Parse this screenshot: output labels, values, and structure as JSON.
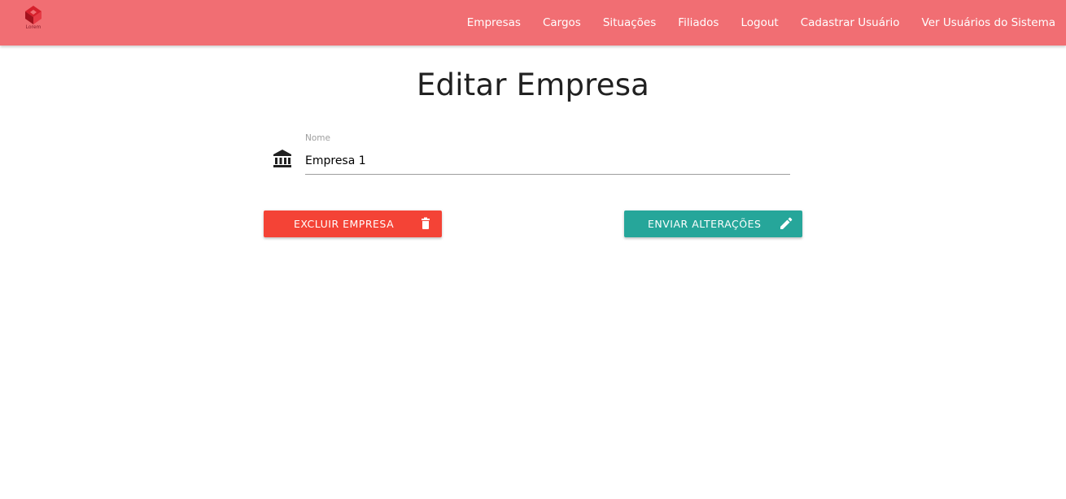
{
  "header": {
    "logo_text": "Lorem",
    "nav": [
      {
        "label": "Empresas"
      },
      {
        "label": "Cargos"
      },
      {
        "label": "Situações"
      },
      {
        "label": "Filiados"
      },
      {
        "label": "Logout"
      },
      {
        "label": "Cadastrar Usuário"
      },
      {
        "label": "Ver Usuários do Sistema"
      }
    ]
  },
  "page": {
    "title": "Editar Empresa"
  },
  "form": {
    "name_field": {
      "label": "Nome",
      "value": "Empresa 1",
      "icon": "bank-icon"
    }
  },
  "actions": {
    "delete_label": "EXCLUIR EMPRESA",
    "delete_icon": "trash-icon",
    "submit_label": "ENVIAR ALTERAÇÕES",
    "submit_icon": "pencil-icon"
  },
  "colors": {
    "navbar": "#f16e73",
    "delete_button": "#f44336",
    "submit_button": "#26a69a"
  }
}
